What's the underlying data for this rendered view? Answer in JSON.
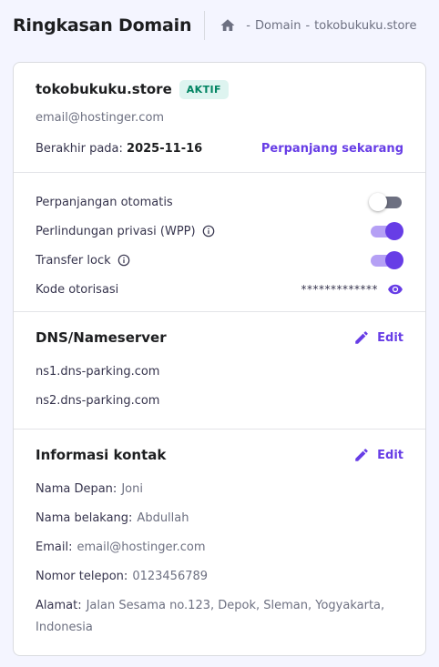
{
  "header": {
    "title": "Ringkasan Domain",
    "breadcrumb": [
      "Domain",
      "tokobukuku.store"
    ]
  },
  "domain": {
    "name": "tokobukuku.store",
    "status": "AKTIF",
    "email": "email@hostinger.com",
    "expiry_label": "Berakhir pada:",
    "expiry_date": "2025-11-16",
    "renew_label": "Perpanjang sekarang"
  },
  "settings": {
    "auto_renew": {
      "label": "Perpanjangan otomatis",
      "enabled": false
    },
    "privacy": {
      "label": "Perlindungan privasi (WPP)",
      "enabled": true
    },
    "transfer_lock": {
      "label": "Transfer lock",
      "enabled": true
    },
    "auth_code": {
      "label": "Kode otorisasi",
      "value": "*************"
    }
  },
  "dns": {
    "title": "DNS/Nameserver",
    "edit_label": "Edit",
    "nameservers": [
      "ns1.dns-parking.com",
      "ns2.dns-parking.com"
    ]
  },
  "contact": {
    "title": "Informasi kontak",
    "edit_label": "Edit",
    "fields": [
      {
        "label": "Nama Depan:",
        "value": "Joni"
      },
      {
        "label": "Nama belakang:",
        "value": "Abdullah"
      },
      {
        "label": "Email:",
        "value": "email@hostinger.com"
      },
      {
        "label": "Nomor telepon:",
        "value": "0123456789"
      },
      {
        "label": "Alamat:",
        "value": "Jalan Sesama no.123, Depok, Sleman, Yogyakarta, Indonesia"
      }
    ]
  },
  "colors": {
    "accent": "#673de6",
    "success": "#008361",
    "success_bg": "#def4f0",
    "background": "#f4f5ff"
  }
}
